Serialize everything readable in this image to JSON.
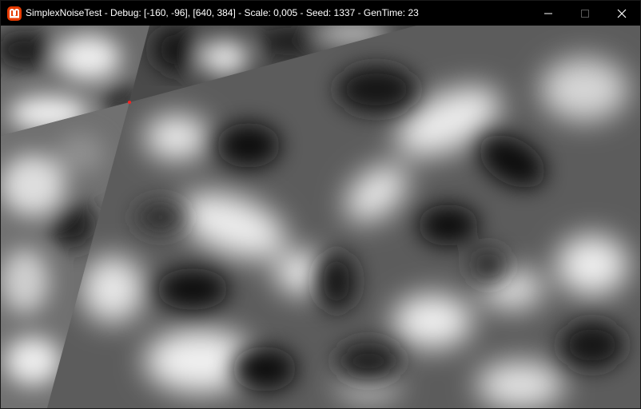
{
  "window": {
    "title": "SimplexNoiseTest - Debug: [-160, -96], [640, 384] - Scale: 0,005 - Seed: 1337 - GenTime: 23",
    "app_icon": "monogame-icon",
    "accent_color": "#e73c00",
    "controls": {
      "minimize_icon": "minimize-icon",
      "maximize_icon": "maximize-icon",
      "close_icon": "close-icon"
    }
  },
  "canvas": {
    "description_icon": "noise-canvas",
    "marker_color": "#ff2020",
    "noise_colors": {
      "light": "#f0f0f0",
      "dark": "#101010"
    }
  }
}
